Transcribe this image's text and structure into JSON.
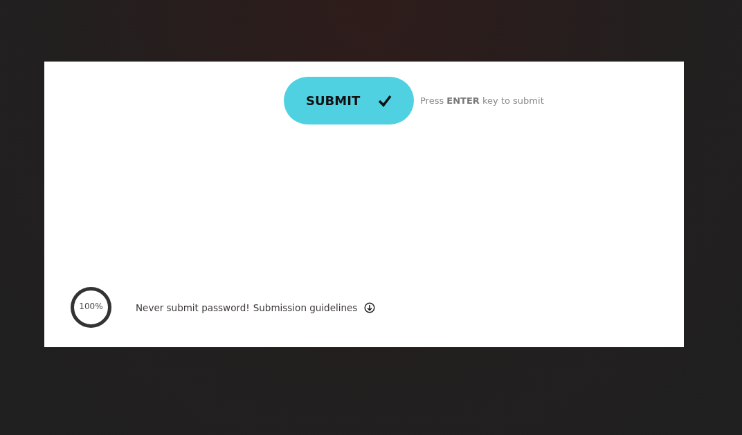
{
  "submit": {
    "label": "SUBMIT",
    "hint": "Press **ENTER** key to submit"
  },
  "progress": {
    "reading": "100%"
  },
  "footer": {
    "warning": "Never submit password!",
    "link": "Submission guidelines"
  }
}
